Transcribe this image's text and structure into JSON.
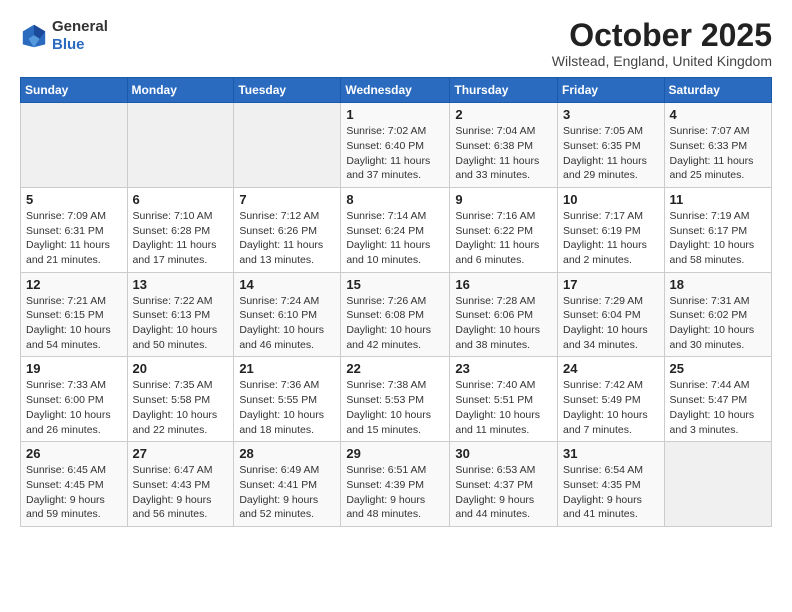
{
  "header": {
    "logo_line1": "General",
    "logo_line2": "Blue",
    "month": "October 2025",
    "location": "Wilstead, England, United Kingdom"
  },
  "days_of_week": [
    "Sunday",
    "Monday",
    "Tuesday",
    "Wednesday",
    "Thursday",
    "Friday",
    "Saturday"
  ],
  "weeks": [
    [
      {
        "day": "",
        "info": ""
      },
      {
        "day": "",
        "info": ""
      },
      {
        "day": "",
        "info": ""
      },
      {
        "day": "1",
        "info": "Sunrise: 7:02 AM\nSunset: 6:40 PM\nDaylight: 11 hours\nand 37 minutes."
      },
      {
        "day": "2",
        "info": "Sunrise: 7:04 AM\nSunset: 6:38 PM\nDaylight: 11 hours\nand 33 minutes."
      },
      {
        "day": "3",
        "info": "Sunrise: 7:05 AM\nSunset: 6:35 PM\nDaylight: 11 hours\nand 29 minutes."
      },
      {
        "day": "4",
        "info": "Sunrise: 7:07 AM\nSunset: 6:33 PM\nDaylight: 11 hours\nand 25 minutes."
      }
    ],
    [
      {
        "day": "5",
        "info": "Sunrise: 7:09 AM\nSunset: 6:31 PM\nDaylight: 11 hours\nand 21 minutes."
      },
      {
        "day": "6",
        "info": "Sunrise: 7:10 AM\nSunset: 6:28 PM\nDaylight: 11 hours\nand 17 minutes."
      },
      {
        "day": "7",
        "info": "Sunrise: 7:12 AM\nSunset: 6:26 PM\nDaylight: 11 hours\nand 13 minutes."
      },
      {
        "day": "8",
        "info": "Sunrise: 7:14 AM\nSunset: 6:24 PM\nDaylight: 11 hours\nand 10 minutes."
      },
      {
        "day": "9",
        "info": "Sunrise: 7:16 AM\nSunset: 6:22 PM\nDaylight: 11 hours\nand 6 minutes."
      },
      {
        "day": "10",
        "info": "Sunrise: 7:17 AM\nSunset: 6:19 PM\nDaylight: 11 hours\nand 2 minutes."
      },
      {
        "day": "11",
        "info": "Sunrise: 7:19 AM\nSunset: 6:17 PM\nDaylight: 10 hours\nand 58 minutes."
      }
    ],
    [
      {
        "day": "12",
        "info": "Sunrise: 7:21 AM\nSunset: 6:15 PM\nDaylight: 10 hours\nand 54 minutes."
      },
      {
        "day": "13",
        "info": "Sunrise: 7:22 AM\nSunset: 6:13 PM\nDaylight: 10 hours\nand 50 minutes."
      },
      {
        "day": "14",
        "info": "Sunrise: 7:24 AM\nSunset: 6:10 PM\nDaylight: 10 hours\nand 46 minutes."
      },
      {
        "day": "15",
        "info": "Sunrise: 7:26 AM\nSunset: 6:08 PM\nDaylight: 10 hours\nand 42 minutes."
      },
      {
        "day": "16",
        "info": "Sunrise: 7:28 AM\nSunset: 6:06 PM\nDaylight: 10 hours\nand 38 minutes."
      },
      {
        "day": "17",
        "info": "Sunrise: 7:29 AM\nSunset: 6:04 PM\nDaylight: 10 hours\nand 34 minutes."
      },
      {
        "day": "18",
        "info": "Sunrise: 7:31 AM\nSunset: 6:02 PM\nDaylight: 10 hours\nand 30 minutes."
      }
    ],
    [
      {
        "day": "19",
        "info": "Sunrise: 7:33 AM\nSunset: 6:00 PM\nDaylight: 10 hours\nand 26 minutes."
      },
      {
        "day": "20",
        "info": "Sunrise: 7:35 AM\nSunset: 5:58 PM\nDaylight: 10 hours\nand 22 minutes."
      },
      {
        "day": "21",
        "info": "Sunrise: 7:36 AM\nSunset: 5:55 PM\nDaylight: 10 hours\nand 18 minutes."
      },
      {
        "day": "22",
        "info": "Sunrise: 7:38 AM\nSunset: 5:53 PM\nDaylight: 10 hours\nand 15 minutes."
      },
      {
        "day": "23",
        "info": "Sunrise: 7:40 AM\nSunset: 5:51 PM\nDaylight: 10 hours\nand 11 minutes."
      },
      {
        "day": "24",
        "info": "Sunrise: 7:42 AM\nSunset: 5:49 PM\nDaylight: 10 hours\nand 7 minutes."
      },
      {
        "day": "25",
        "info": "Sunrise: 7:44 AM\nSunset: 5:47 PM\nDaylight: 10 hours\nand 3 minutes."
      }
    ],
    [
      {
        "day": "26",
        "info": "Sunrise: 6:45 AM\nSunset: 4:45 PM\nDaylight: 9 hours\nand 59 minutes."
      },
      {
        "day": "27",
        "info": "Sunrise: 6:47 AM\nSunset: 4:43 PM\nDaylight: 9 hours\nand 56 minutes."
      },
      {
        "day": "28",
        "info": "Sunrise: 6:49 AM\nSunset: 4:41 PM\nDaylight: 9 hours\nand 52 minutes."
      },
      {
        "day": "29",
        "info": "Sunrise: 6:51 AM\nSunset: 4:39 PM\nDaylight: 9 hours\nand 48 minutes."
      },
      {
        "day": "30",
        "info": "Sunrise: 6:53 AM\nSunset: 4:37 PM\nDaylight: 9 hours\nand 44 minutes."
      },
      {
        "day": "31",
        "info": "Sunrise: 6:54 AM\nSunset: 4:35 PM\nDaylight: 9 hours\nand 41 minutes."
      },
      {
        "day": "",
        "info": ""
      }
    ]
  ]
}
